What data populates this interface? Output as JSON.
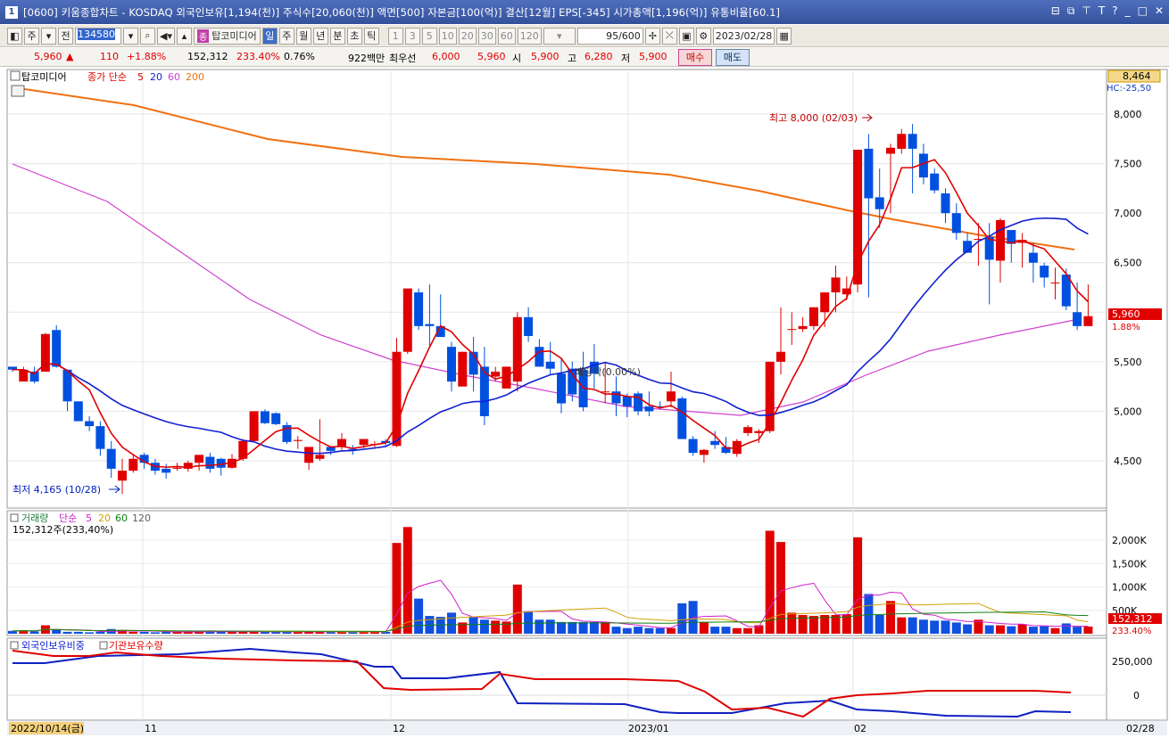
{
  "titlebar": {
    "icon_label": "1",
    "title": "[0600] 키움종합차트 - KOSDAQ 외국인보유[1,194(천)] 주식수[20,060(천)] 액면[500] 자본금[100(억)] 결산[12월] EPS[-345] 시가총액[1,196(억)] 유통비율[60.1]"
  },
  "toolbar": {
    "period_label": "주",
    "prev_label": "전",
    "code": "134580",
    "stock_name": "탑코미디어",
    "stock_badge": "종",
    "tabs": [
      "일",
      "주",
      "월",
      "년",
      "분",
      "초",
      "틱"
    ],
    "minute_options": [
      "1",
      "3",
      "5",
      "10",
      "20",
      "30",
      "60",
      "120"
    ],
    "count": "95",
    "count_total": "/600",
    "date": "2023/02/28"
  },
  "pricebar": {
    "price": "5,960",
    "change_arrow": "▲",
    "change": "110",
    "change_pct": "+1.88%",
    "volume": "152,312",
    "volume_ratio": "233.40%",
    "turnover": "0.76%",
    "amount": "922백만",
    "order_label": "최우선",
    "ask": "6,000",
    "bid": "5,960",
    "open_label": "시",
    "open": "5,900",
    "high_label": "고",
    "high": "6,280",
    "low_label": "저",
    "low": "5,900",
    "buy_label": "매수",
    "sell_label": "매도"
  },
  "price_panel": {
    "title": "탑코미디어",
    "legend_prefix": "종가 단순",
    "ma_labels": [
      "5",
      "20",
      "60",
      "200"
    ],
    "ma_colors": [
      "#e00000",
      "#1020d0",
      "#d040d0",
      "#f07010"
    ],
    "y_ticks": [
      "8,000",
      "7,500",
      "7,000",
      "6,500",
      "6,000",
      "5,500",
      "5,000",
      "4,500"
    ],
    "top_value": "8,464",
    "top_sub": "HC:-25,50",
    "current_value": "5,960",
    "current_pct": "1.88%",
    "high_annot": "최고 8,000 (02/03)",
    "low_annot": "최저 4,165 (10/28)",
    "event_annot": "배당락(0.00%)"
  },
  "volume_panel": {
    "title": "거래량",
    "legend_prefix": "단순",
    "ma_labels": [
      "5",
      "20",
      "60",
      "120"
    ],
    "ma_colors": [
      "#d020d0",
      "#d0a000",
      "#108010",
      "#606060"
    ],
    "readout": "152,312주(233,40%)",
    "y_ticks": [
      "2,000K",
      "1,500K",
      "1,000K",
      "500K"
    ],
    "current_value": "152,312",
    "current_pct": "233.40%"
  },
  "holding_panel": {
    "legend_1": "외국인보유비중",
    "legend_2": "기관보유수량",
    "y_ticks": [
      "250,000",
      "0"
    ]
  },
  "x_axis": {
    "start_label": "2022/10/14(금)",
    "labels": [
      "11",
      "12",
      "2023/01",
      "02"
    ],
    "end_label": "02/28"
  },
  "chart_data": {
    "type": "candlestick",
    "x": [
      "2022-10-14",
      "2023-02-28"
    ],
    "ylim": [
      4165,
      8464
    ],
    "ohlc_price_ticks": [
      8000,
      7500,
      7000,
      6500,
      6000,
      5500,
      5000,
      4500
    ],
    "last_close": 5960,
    "high": 8000,
    "low": 4165,
    "volume_last": 152312
  }
}
